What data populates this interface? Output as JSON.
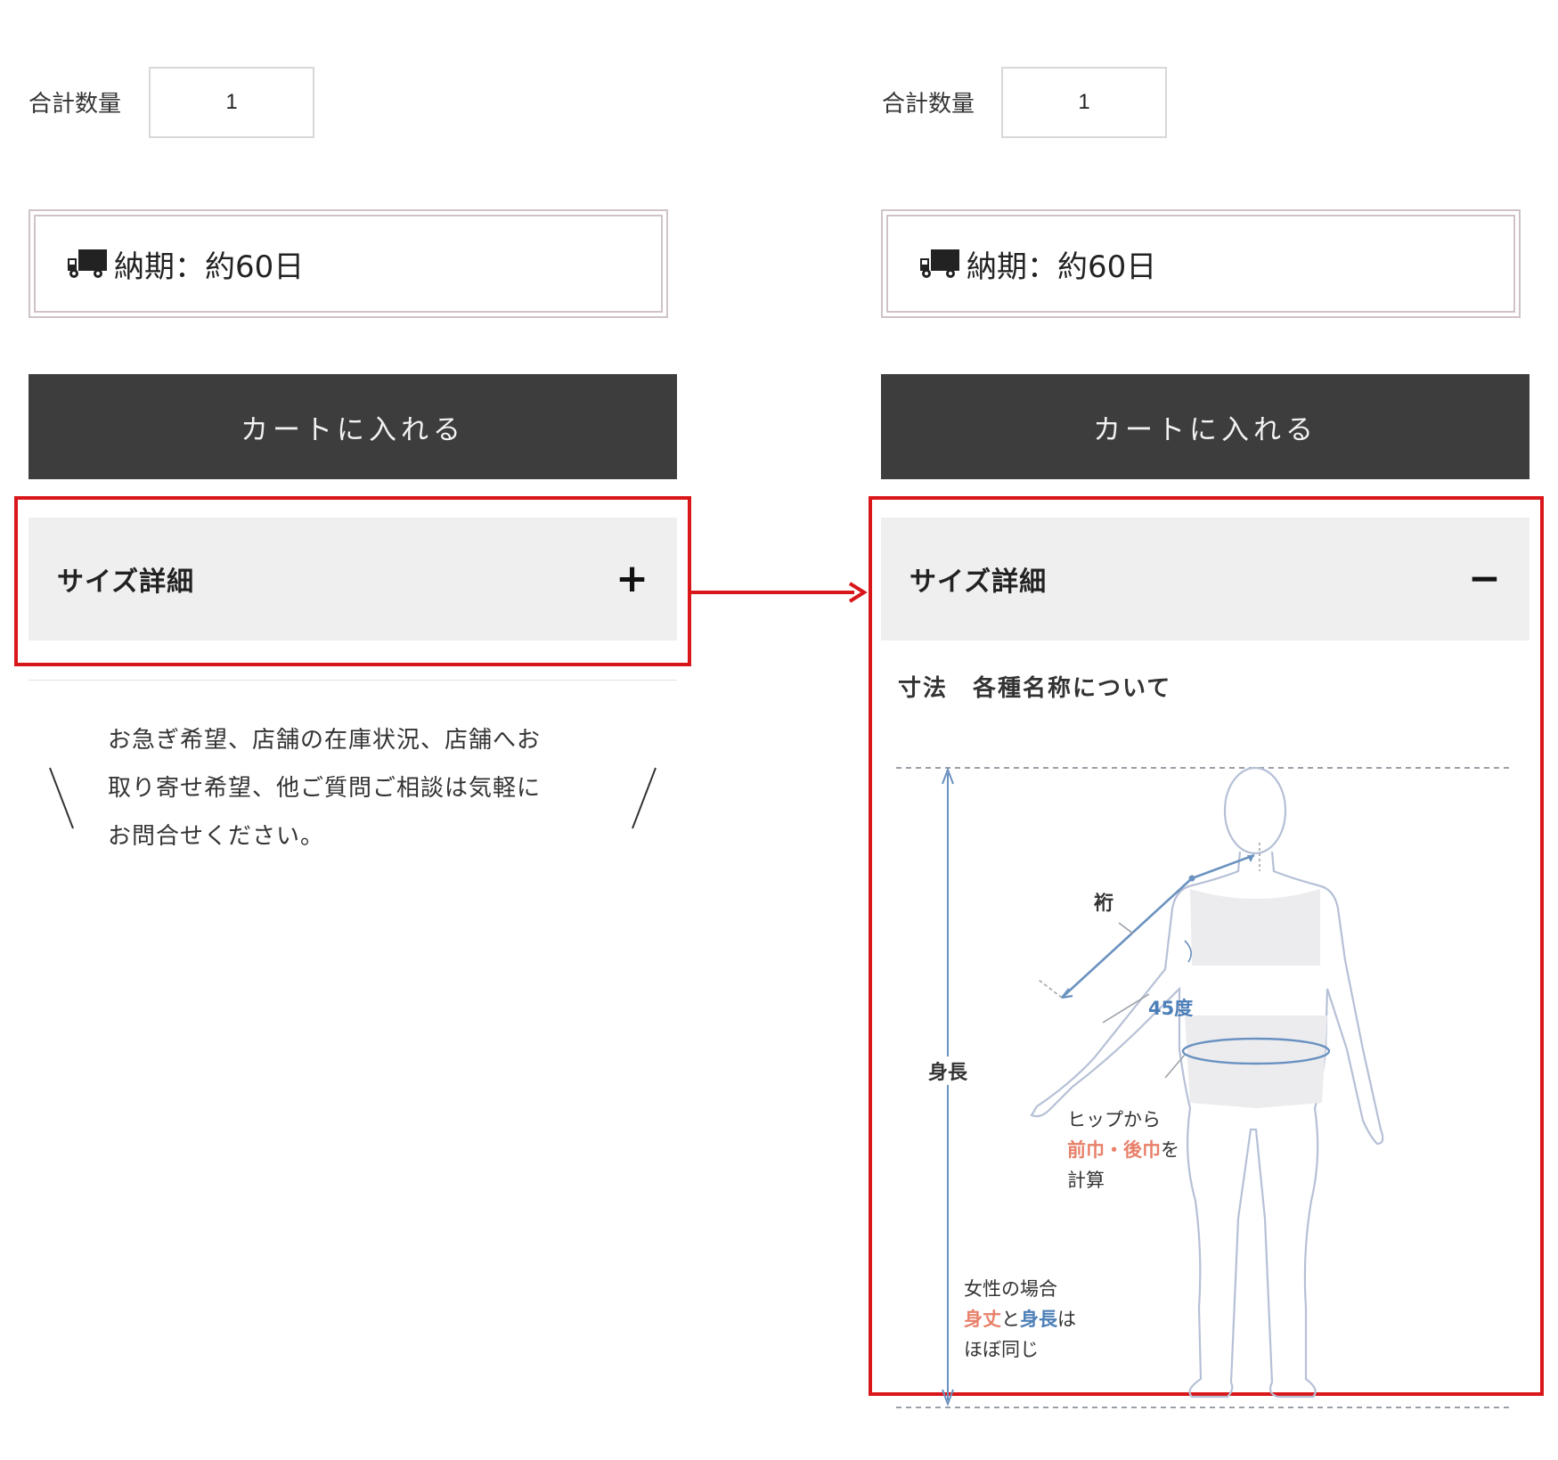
{
  "left": {
    "qty_label": "合計数量",
    "qty_value": "1",
    "delivery_text": "納期：約60日",
    "cart_label": "カートに入れる",
    "accordion_title": "サイズ詳細",
    "accordion_toggle": "+",
    "contact_lines": [
      "お急ぎ希望、店舗の在庫状況、店舗へお",
      "取り寄せ希望、他ご質問ご相談は気軽に",
      "お問合せください。"
    ]
  },
  "right": {
    "qty_label": "合計数量",
    "qty_value": "1",
    "delivery_text": "納期：約60日",
    "cart_label": "カートに入れる",
    "accordion_title": "サイズ詳細",
    "accordion_toggle": "−",
    "diagram_title": "寸法　各種名称について",
    "diagram": {
      "label_sleeve": "裄",
      "label_angle": "45度",
      "label_height": "身長",
      "hip_line1": "ヒップから",
      "hip_red": "前巾・後巾",
      "hip_suffix": "を",
      "hip_line3": "計算",
      "women_line1": "女性の場合",
      "women_red": "身丈",
      "women_mid": "と",
      "women_blue": "身長",
      "women_suffix": "は",
      "women_line3": "ほぼ同じ"
    }
  },
  "colors": {
    "highlight": "#d9161a",
    "button": "#3d3d3d",
    "accent_red": "#e8806a",
    "accent_blue": "#4d7fb8",
    "line_blue": "#6a92c0"
  },
  "icons": {
    "truck": "truck-icon"
  }
}
